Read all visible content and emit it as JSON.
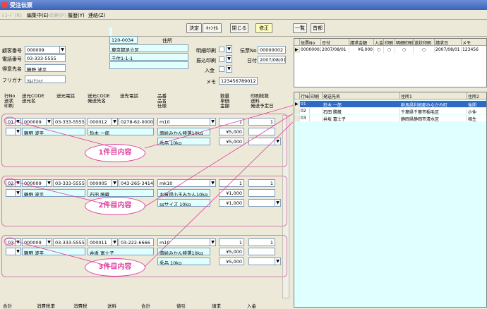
{
  "window": {
    "title": "受注伝票"
  },
  "menu": {
    "items": [
      "ﾚｺｰﾄﾞ(R)",
      "編集中(E)",
      "印刷(P)",
      "履歴(Y)",
      "連絡(Z)"
    ]
  },
  "toolbar": {
    "confirm": "決定",
    "cancel": "ｷｬﾝｾﾙ",
    "close": "閉じる",
    "edit": "修正",
    "list": "一覧",
    "memo": "首都"
  },
  "customer": {
    "labels": {
      "code": "顧客番号",
      "phone": "電話番号",
      "name": "得意先名",
      "furigana": "フリガナ",
      "address": "住所"
    },
    "code": "000009",
    "phone": "03-333-5555",
    "name": "鶴野 波平",
    "furigana": "ﾂﾙﾉﾅﾐﾍｲ",
    "zip": "120-0034",
    "address1": "東京都足立区",
    "address2": "千住1-1-1"
  },
  "slip": {
    "labels": {
      "detail_print": "明細印刷",
      "transfer_print": "振込印刷",
      "payment": "入金",
      "slip_no": "伝票No",
      "date": "日付",
      "memo": "メモ"
    },
    "slip_no": "00000002",
    "date": "2007/08/01",
    "memo": "123456789012"
  },
  "detail_headers": {
    "row_no": "行No\n送状\n印刷",
    "dest_code": "送元CODE\n送元名",
    "dest_phone": "送元電話",
    "to_code": "送元CODE\n発送先名",
    "to_phone": "送先電話",
    "item": "品番\n品名\n仕様",
    "qty": "数量\n単価\n金額",
    "print_count": "印刷枚数\n送料\n発送予定日"
  },
  "rows": [
    {
      "no": "01",
      "src_code": "000009",
      "src_phone": "03-333-5555",
      "src_name": "鶴野 波平",
      "to_code": "000012",
      "to_phone": "0278-62-0000",
      "to_name": "鈴木 一郎",
      "item_code": "m10",
      "item_name": "南絵みかん特選10kg",
      "spec": "秀品 10kg",
      "qty": "1",
      "price": "¥5,000",
      "amount": "¥5,000",
      "print_count": "1",
      "note": "1件目内容"
    },
    {
      "no": "02",
      "src_code": "000009",
      "src_phone": "03-333-5555",
      "src_name": "鶴野 波平",
      "to_code": "000005",
      "to_phone": "043-265-3414",
      "to_name": "石田 勝蔵",
      "item_code": "mk10",
      "item_name": "お買得小玉みかん10kg",
      "spec": "ssサイズ 10kg",
      "qty": "1",
      "price": "¥1,000",
      "amount": "¥1,000",
      "print_count": "1",
      "note": "2件目内容"
    },
    {
      "no": "03",
      "src_code": "000009",
      "src_phone": "03-333-5555",
      "src_name": "鶴野 波平",
      "to_code": "000011",
      "to_phone": "03-222-6666",
      "to_name": "井坂 富士子",
      "item_code": "m10",
      "item_name": "南絵みかん特選10kg",
      "spec": "秀品 10kg",
      "qty": "1",
      "price": "¥5,000",
      "amount": "¥5,000",
      "print_count": "1",
      "note": "3件目内容"
    }
  ],
  "bottom_headers": [
    "合計",
    "消費税率",
    "消費税",
    "送料",
    "合計",
    "値引",
    "請求",
    "入金"
  ],
  "slip_grid": {
    "headers": [
      "伝票No",
      "日付",
      "請求金額",
      "入金",
      "印刷",
      "明細印刷",
      "送状印刷",
      "請求日",
      "メモ"
    ],
    "row": [
      "00000002",
      "2007/08/01",
      "¥6,000",
      "○",
      "○",
      "○",
      "○",
      "2007/08/01",
      "123456"
    ]
  },
  "dest_grid": {
    "headers": [
      "行No",
      "印刷",
      "発送先名",
      "住所1",
      "住所2"
    ],
    "rows": [
      [
        "01",
        "",
        "鈴木 一郎",
        "群馬県利根郡みなかみ町",
        "後閑"
      ],
      [
        "02",
        "",
        "石田 勝蔵",
        "千葉県千葉市稲毛区",
        "小仲"
      ],
      [
        "03",
        "",
        "井坂 富士子",
        "静岡県静岡市清水区",
        "相生"
      ]
    ]
  },
  "colors": {
    "accent_pink": "#e040a0",
    "cyan_field": "#e0ffff",
    "selected_row": "#316ac5"
  }
}
